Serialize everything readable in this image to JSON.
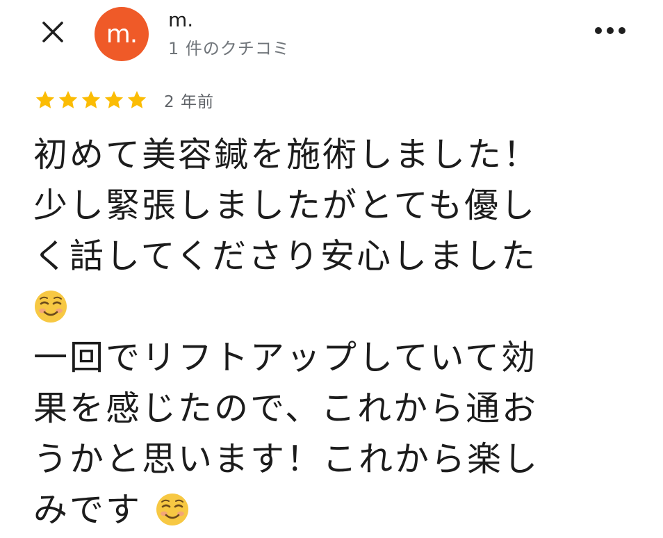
{
  "header": {
    "close_icon": "close-icon",
    "avatar_text": "m.",
    "avatar_color": "#ef5a28",
    "reviewer_name": "m.",
    "review_count": "1 件のクチコミ",
    "more_icon": "more-vert-icon"
  },
  "review": {
    "rating": 5,
    "rating_max": 5,
    "star_color": "#fbbc04",
    "age": "2 年前",
    "lines": [
      "初めて美容鍼を施術しました！",
      "少し緊張しましたがとても優し",
      "く話してくださり安心しました",
      "一回でリフトアップしていて効",
      "果を感じたので、これから通お",
      "うかと思います！これから楽し",
      "みです"
    ],
    "emoji_name": "smiling-face-icon"
  }
}
